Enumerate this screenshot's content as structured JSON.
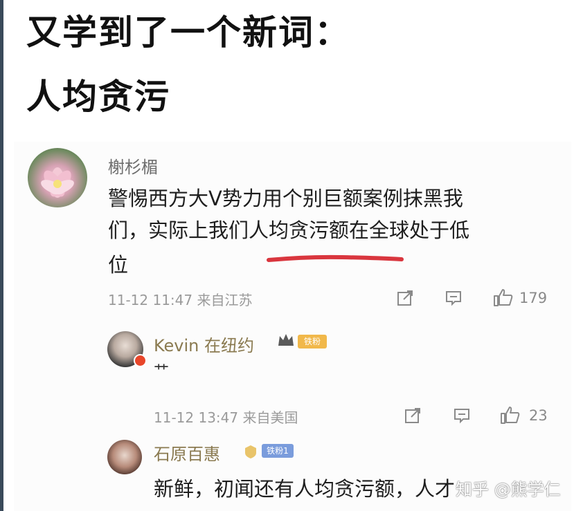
{
  "headline": {
    "line1": "又学到了一个新词：",
    "line2": "人均贪污"
  },
  "main_comment": {
    "username": "榭杉楣",
    "text_lines": [
      "警惕西方大V势力用个别巨额案例抹黑我",
      "们，实际上我们人均贪污额在全球处于低",
      "位"
    ],
    "meta": "11-12 11:47 来自江苏",
    "like_count": "179",
    "underline_color": "#d9363e"
  },
  "replies": [
    {
      "username": "Kevin 在纽约",
      "badge": "铁粉",
      "text": "艹",
      "meta": "11-12 13:47 来自美国",
      "like_count": "23"
    },
    {
      "username": "石原百惠",
      "badge": "铁粉1",
      "text": "新鲜，初闻还有人均贪污额，人才"
    }
  ],
  "watermark": "知乎 @熊学仁",
  "icons": [
    "share-icon",
    "comment-icon",
    "like-icon"
  ]
}
